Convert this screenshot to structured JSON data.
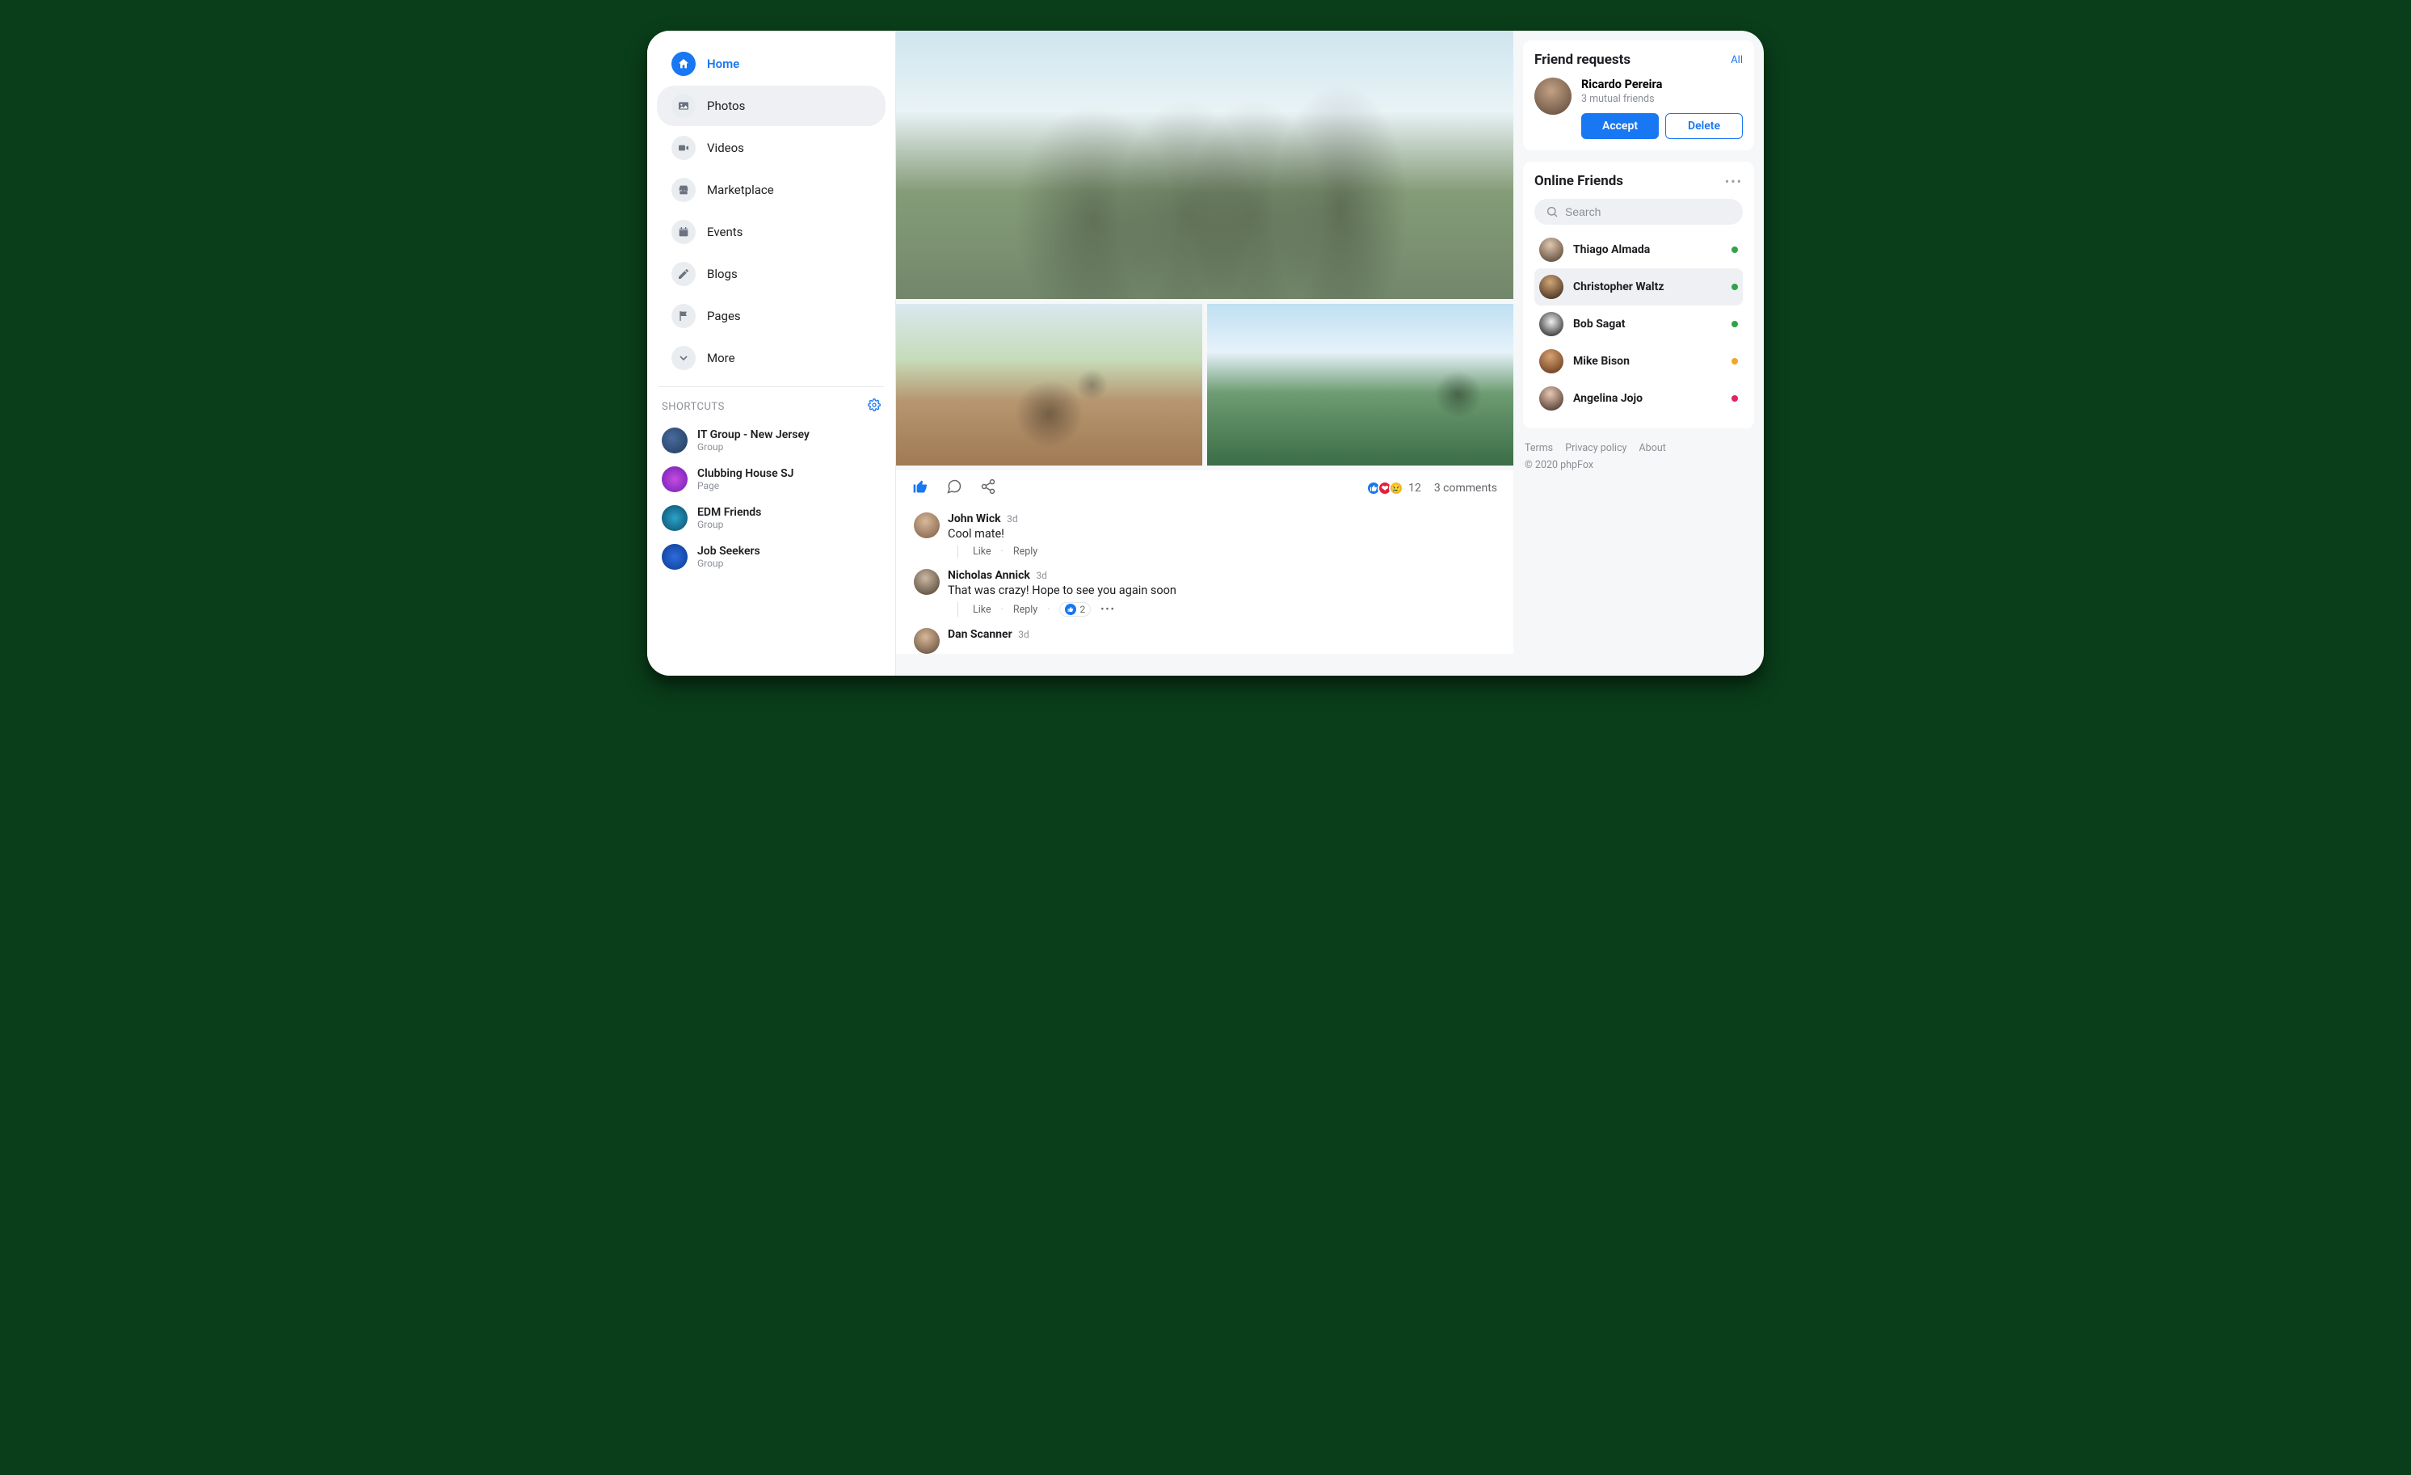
{
  "nav": {
    "items": [
      {
        "label": "Home",
        "active": true
      },
      {
        "label": "Photos",
        "selected": true
      },
      {
        "label": "Videos"
      },
      {
        "label": "Marketplace"
      },
      {
        "label": "Events"
      },
      {
        "label": "Blogs"
      },
      {
        "label": "Pages"
      },
      {
        "label": "More"
      }
    ],
    "shortcuts_header": "SHORTCUTS",
    "shortcuts": [
      {
        "name": "IT Group - New Jersey",
        "type": "Group"
      },
      {
        "name": "Clubbing House SJ",
        "type": "Page"
      },
      {
        "name": "EDM Friends",
        "type": "Group"
      },
      {
        "name": "Job Seekers",
        "type": "Group"
      }
    ]
  },
  "post": {
    "reaction_count": "12",
    "comments_count": "3 comments",
    "comments": [
      {
        "author": "John Wick",
        "age": "3d",
        "text": "Cool mate!",
        "actions": {
          "like": "Like",
          "reply": "Reply"
        }
      },
      {
        "author": "Nicholas Annick",
        "age": "3d",
        "text": "That was crazy! Hope to see you again soon",
        "actions": {
          "like": "Like",
          "reply": "Reply",
          "react_count": "2",
          "dots": "•••"
        }
      },
      {
        "author": "Dan Scanner",
        "age": "3d"
      }
    ]
  },
  "friend_requests": {
    "title": "Friend requests",
    "all": "All",
    "request": {
      "name": "Ricardo Pereira",
      "mutual": "3 mutual friends",
      "accept": "Accept",
      "delete": "Delete"
    }
  },
  "online": {
    "title": "Online Friends",
    "search_placeholder": "Search",
    "friends": [
      {
        "name": "Thiago Almada",
        "status": "green"
      },
      {
        "name": "Christopher Waltz",
        "status": "green",
        "highlight": true
      },
      {
        "name": "Bob Sagat",
        "status": "green"
      },
      {
        "name": "Mike Bison",
        "status": "yellow"
      },
      {
        "name": "Angelina Jojo",
        "status": "red"
      }
    ]
  },
  "footer": {
    "terms": "Terms",
    "privacy": "Privacy policy",
    "about": "About",
    "copyright": "© 2020 phpFox"
  }
}
